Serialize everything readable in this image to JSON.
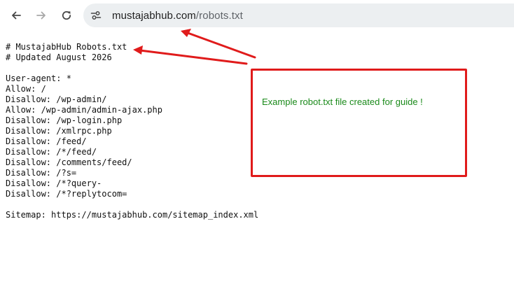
{
  "browser": {
    "url_host": "mustajabhub.com",
    "url_path": "/robots.txt"
  },
  "document": {
    "lines": [
      "# MustajabHub Robots.txt",
      "# Updated August 2026",
      "",
      "User-agent: *",
      "Allow: /",
      "Disallow: /wp-admin/",
      "Allow: /wp-admin/admin-ajax.php",
      "Disallow: /wp-login.php",
      "Disallow: /xmlrpc.php",
      "Disallow: /feed/",
      "Disallow: /*/feed/",
      "Disallow: /comments/feed/",
      "Disallow: /?s=",
      "Disallow: /*?query-",
      "Disallow: /*?replytocom=",
      "",
      "Sitemap: https://mustajabhub.com/sitemap_index.xml"
    ]
  },
  "annotation": {
    "text": "Example robot.txt file created for guide !",
    "color": "#1a8a1a",
    "box_color": "#e01b1b"
  },
  "icons": {
    "back": "arrow-left-icon",
    "forward": "arrow-right-icon",
    "reload": "reload-icon",
    "site_info": "tune-icon"
  }
}
